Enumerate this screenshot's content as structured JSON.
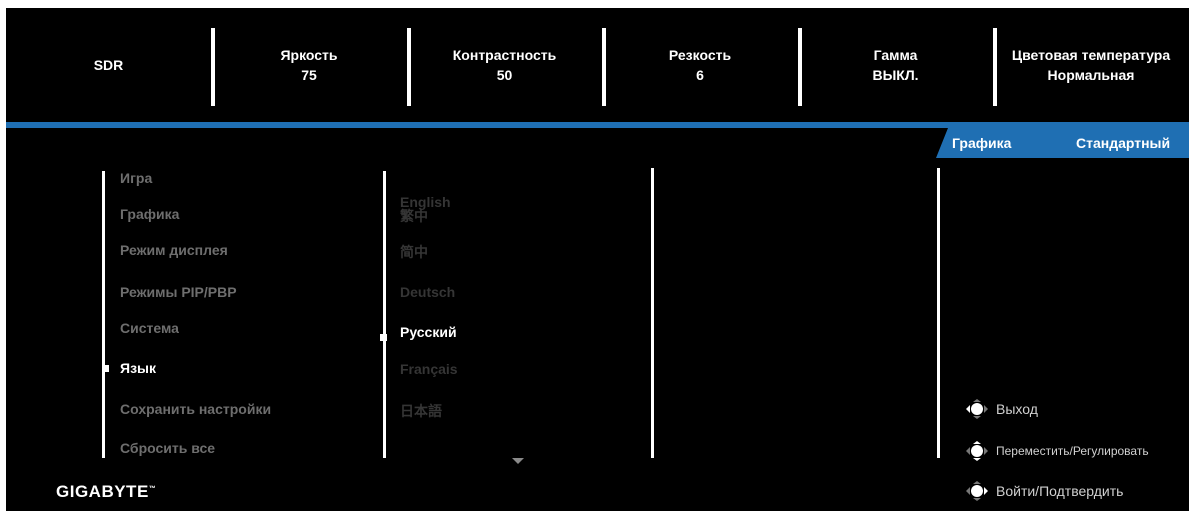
{
  "header": {
    "mode": "SDR",
    "brightness": {
      "label": "Яркость",
      "value": "75"
    },
    "contrast": {
      "label": "Контрастность",
      "value": "50"
    },
    "sharpness": {
      "label": "Резкость",
      "value": "6"
    },
    "gamma": {
      "label": "Гамма",
      "value": "ВЫКЛ."
    },
    "color_temp": {
      "label": "Цветовая температура",
      "value": "Нормальная"
    }
  },
  "tabs": {
    "graphics": "Графика",
    "standard": "Стандартный"
  },
  "main_menu": [
    "Игра",
    "Графика",
    "Режим дисплея",
    "Режимы PIP/PBP",
    "Система",
    "Язык",
    "Сохранить настройки",
    "Сбросить все"
  ],
  "main_menu_selected": "Язык",
  "languages": [
    "English",
    "繁中",
    "简中",
    "Deutsch",
    "Русский",
    "Français",
    "日本語"
  ],
  "language_selected": "Русский",
  "logo": "GIGABYTE",
  "help": {
    "exit": "Выход",
    "move": "Переместить/Регулировать",
    "confirm": "Войти/Подтвердить"
  },
  "colors": {
    "accent": "#1f6fb3",
    "background": "#000000",
    "text": "#ffffff",
    "inactive": "#6e6e6e"
  }
}
